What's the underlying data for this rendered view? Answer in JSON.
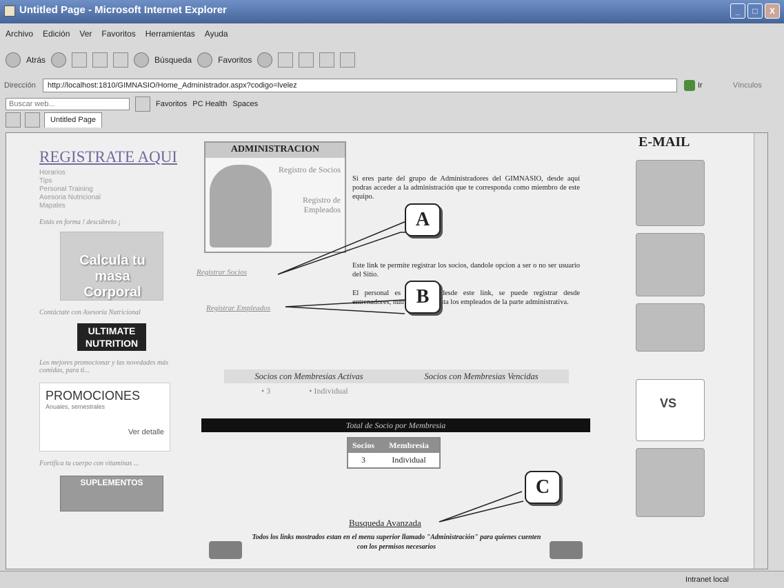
{
  "window": {
    "title": "Untitled Page - Microsoft Internet Explorer",
    "buttons": [
      "_",
      "□",
      "X"
    ]
  },
  "menu": [
    "Archivo",
    "Edición",
    "Ver",
    "Favoritos",
    "Herramientas",
    "Ayuda"
  ],
  "toolbar": {
    "back": "Atrás",
    "search": "Búsqueda",
    "favorites": "Favoritos"
  },
  "address": {
    "label": "Dirección",
    "url": "http://localhost:1810/GIMNASIO/Home_Administrador.aspx?codigo=lvelez",
    "go": "Ir",
    "links": "Vínculos"
  },
  "searchbar": {
    "placeholder": "Buscar web...",
    "items": [
      "Favoritos",
      "PC Health",
      "Spaces"
    ]
  },
  "tabs": {
    "active": "Untitled Page"
  },
  "left": {
    "title": "REGISTRATE AQUI",
    "nav": [
      "Horarios",
      "Tips",
      "Personal Training",
      "Asesoria Nutricional",
      "Mapales"
    ],
    "tagline": "Estás en forma ! descúbrelo ¡",
    "calc": "Calcula tu masa Corporal",
    "consult": "Contáctate con Asesoría Nutricional",
    "ultimate": "ULTIMATE NUTRITION",
    "bestmsg": "Los mejores promocionar y las novedades más comidas, para ti...",
    "promo_title": "PROMOCIONES",
    "promo_sub": "Anuales, semestrales",
    "promo_det": "Ver detalle",
    "vitamins": "Fortifica tu cuerpo con vitaminas ...",
    "supp": "SUPLEMENTOS"
  },
  "admin": {
    "header": "ADMINISTRACION",
    "link1": "Registro de Socios",
    "link2": "Registro de Empleados"
  },
  "intro": "Si eres parte del grupo de Administradores del GIMNASIO, desde aquí podras acceder a la administración que te corresponda como miembro de este equipo.",
  "links": {
    "socios": "Registrar Socios",
    "empleados": "Registrar Empleados",
    "socios_desc": "Este link te permite registrar los socios, dandole opcion a ser o no ser usuario del Sitio.",
    "empleados_desc": "El personal es registrado desde este link, se puede registrar desde entrenadores, nutricionistas hasta los empleados de la parte administrativa."
  },
  "callouts": [
    "A",
    "B",
    "C"
  ],
  "membership": {
    "active": "Socios con Membresias Activas",
    "expired": "Socios con Membresias Vencidas",
    "count": "• 3",
    "type": "• Individual"
  },
  "total": {
    "bar": "Total de Socio por Membresia",
    "headers": [
      "Socios",
      "Membresia"
    ],
    "rows": [
      [
        "3",
        "Individual"
      ]
    ]
  },
  "busqueda": "Busqueda Avanzada",
  "note": "Todos los links mostrados estan en el menu superior llamado \"Administración\" para quienes cuenten con los permisos necesarios",
  "right": {
    "email": "E-MAIL",
    "vs": "VS"
  },
  "status": {
    "zone": "Intranet local"
  }
}
